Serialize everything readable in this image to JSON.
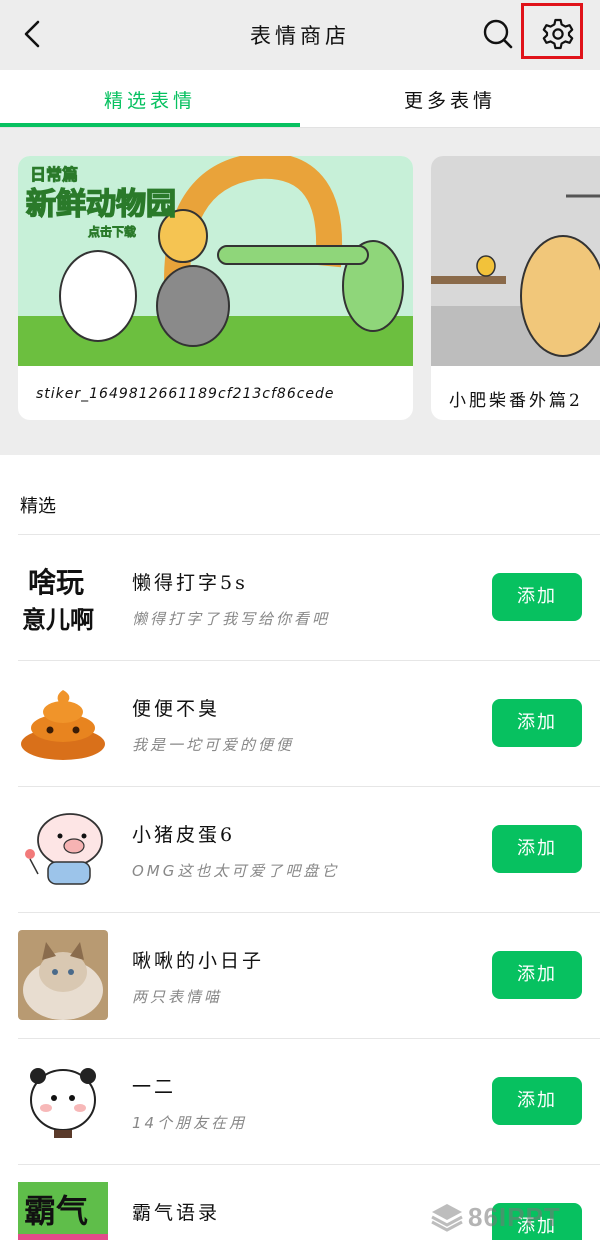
{
  "header": {
    "title": "表情商店",
    "back_icon": "back-chevron-icon",
    "search_icon": "search-icon",
    "settings_icon": "gear-icon"
  },
  "tabs": [
    {
      "label": "精选表情",
      "selected": true
    },
    {
      "label": "更多表情",
      "selected": false
    }
  ],
  "banners": [
    {
      "caption": "stiker_1649812661189cf213cf86cede",
      "image_text_line1": "日常篇",
      "image_text_line2": "新鲜动物园",
      "image_text_line3": "点击下载"
    },
    {
      "caption": "小肥柴番外篇2"
    }
  ],
  "section": {
    "title": "精选"
  },
  "items": [
    {
      "name": "懒得打字5s",
      "desc": "懒得打字了我写给你看吧",
      "button": "添加",
      "thumb_text_1": "啥玩",
      "thumb_text_2": "意儿啊"
    },
    {
      "name": "便便不臭",
      "desc": "我是一坨可爱的便便",
      "button": "添加"
    },
    {
      "name": "小猪皮蛋6",
      "desc": "OMG这也太可爱了吧盘它",
      "button": "添加"
    },
    {
      "name": "啾啾的小日子",
      "desc": "两只表情喵",
      "button": "添加"
    },
    {
      "name": "一二",
      "desc": "14个朋友在用",
      "button": "添加"
    },
    {
      "name": "霸气语录",
      "desc": "",
      "button": "添加",
      "thumb_text_1": "霸气"
    }
  ],
  "watermark": "86IPPT",
  "colors": {
    "accent": "#07c160",
    "highlight": "#e0131a",
    "background": "#ededed"
  }
}
